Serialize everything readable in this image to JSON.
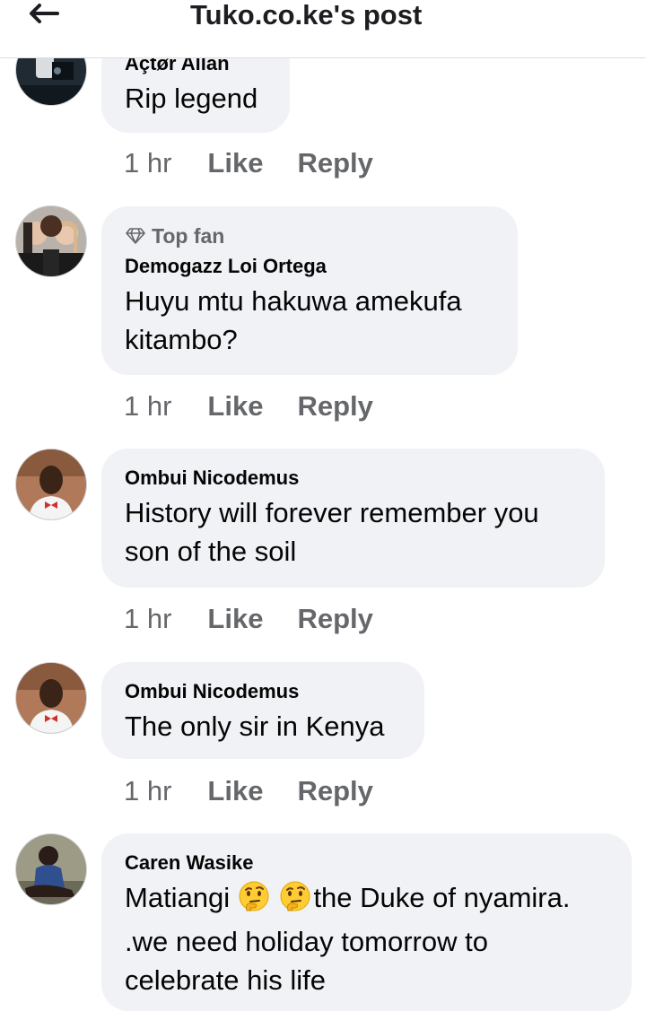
{
  "header": {
    "title": "Tuko.co.ke's post",
    "back_icon": "arrow-left-icon"
  },
  "comments": [
    {
      "author": "Açtør Allan",
      "lines": [
        "Rip legend"
      ],
      "time": "1 hr",
      "like_label": "Like",
      "reply_label": "Reply"
    },
    {
      "badge": "Top fan",
      "author": "Demogazz Loi Ortega",
      "lines": [
        "Huyu mtu hakuwa amekufa",
        "kitambo?"
      ],
      "time": "1 hr",
      "like_label": "Like",
      "reply_label": "Reply"
    },
    {
      "author": "Ombui Nicodemus",
      "lines": [
        "History will forever remember you",
        "son of the soil"
      ],
      "time": "1 hr",
      "like_label": "Like",
      "reply_label": "Reply"
    },
    {
      "author": "Ombui Nicodemus",
      "lines": [
        "The only sir in Kenya"
      ],
      "time": "1 hr",
      "like_label": "Like",
      "reply_label": "Reply"
    },
    {
      "author": "Caren Wasike",
      "line1_prefix": "Matiangi",
      "line1_suffix": "the Duke of nyamira.",
      "lines": [
        ".we need holiday tomorrow to",
        "celebrate his life"
      ],
      "emoji": "thinking-face-icon"
    }
  ],
  "colors": {
    "bubble": "#f0f2f5",
    "meta": "#65676b",
    "text": "#050505"
  }
}
